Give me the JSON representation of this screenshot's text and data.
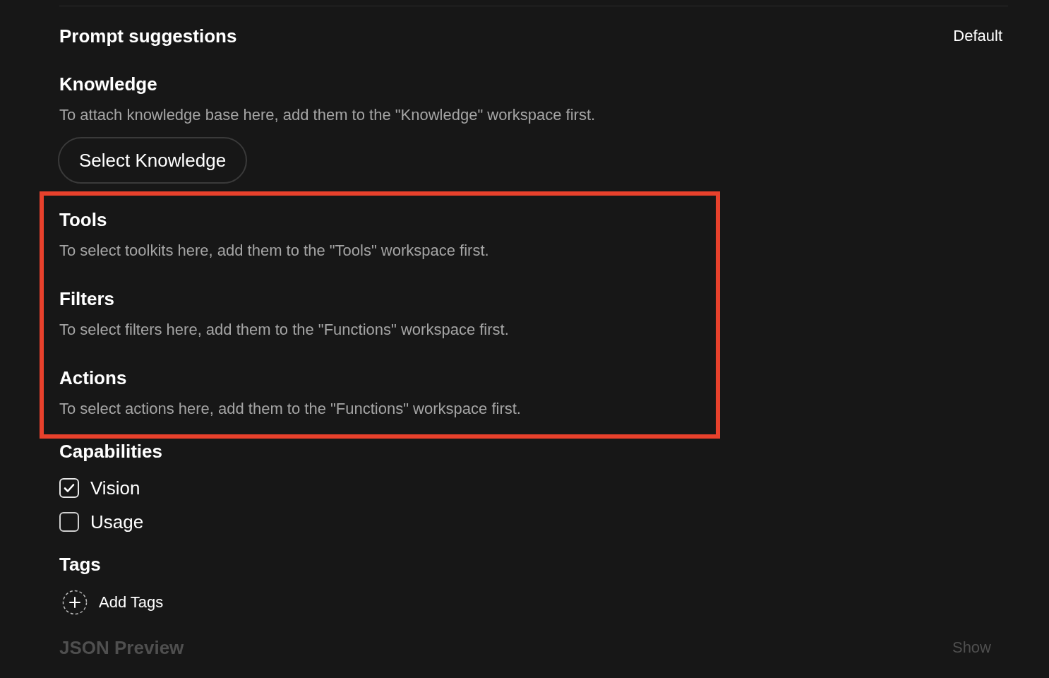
{
  "prompt_suggestions": {
    "label": "Prompt suggestions",
    "value": "Default"
  },
  "sections": [
    {
      "title": "Knowledge",
      "description": "To attach knowledge base here, add them to the \"Knowledge\" workspace first.",
      "button": "Select Knowledge",
      "highlighted": false
    },
    {
      "title": "Tools",
      "description": "To select toolkits here, add them to the \"Tools\" workspace first.",
      "highlighted": true
    },
    {
      "title": "Filters",
      "description": "To select filters here, add them to the \"Functions\" workspace first.",
      "highlighted": true
    },
    {
      "title": "Actions",
      "description": "To select actions here, add them to the \"Functions\" workspace first.",
      "highlighted": true
    }
  ],
  "capabilities": {
    "title": "Capabilities",
    "items": [
      {
        "label": "Vision",
        "checked": true
      },
      {
        "label": "Usage",
        "checked": false
      }
    ]
  },
  "tags": {
    "title": "Tags",
    "add_label": "Add Tags"
  },
  "json_preview": {
    "title": "JSON Preview",
    "toggle": "Show"
  }
}
